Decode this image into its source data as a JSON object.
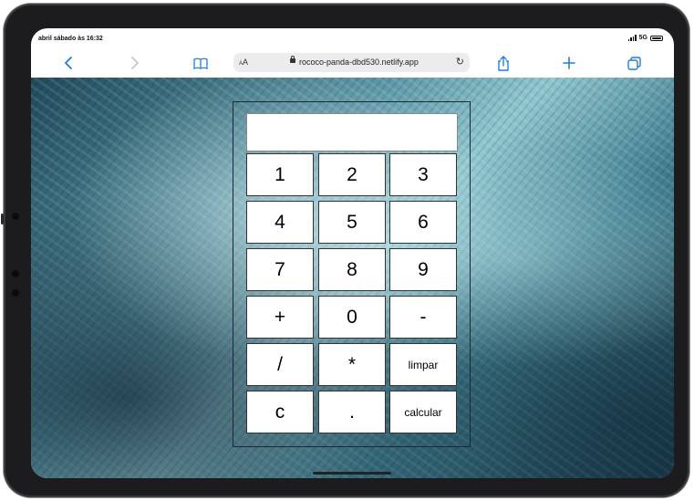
{
  "status": {
    "time": "abril sábado às 16:32",
    "network": "5G"
  },
  "browser": {
    "text_size_label": "AA",
    "url": "rococo-panda-dbd530.netlify.app"
  },
  "calculator": {
    "display_value": "",
    "rows": [
      [
        {
          "label": "1"
        },
        {
          "label": "2"
        },
        {
          "label": "3"
        }
      ],
      [
        {
          "label": "4"
        },
        {
          "label": "5"
        },
        {
          "label": "6"
        }
      ],
      [
        {
          "label": "7"
        },
        {
          "label": "8"
        },
        {
          "label": "9"
        }
      ],
      [
        {
          "label": "+"
        },
        {
          "label": "0"
        },
        {
          "label": "-"
        }
      ],
      [
        {
          "label": "/"
        },
        {
          "label": "*"
        },
        {
          "label": "limpar"
        }
      ],
      [
        {
          "label": "c"
        },
        {
          "label": "."
        },
        {
          "label": "calcular"
        }
      ]
    ]
  },
  "icons": [
    "back-icon",
    "forward-icon",
    "bookmarks-icon",
    "lock-icon",
    "reload-icon",
    "share-icon",
    "new-tab-icon",
    "tabs-icon"
  ]
}
